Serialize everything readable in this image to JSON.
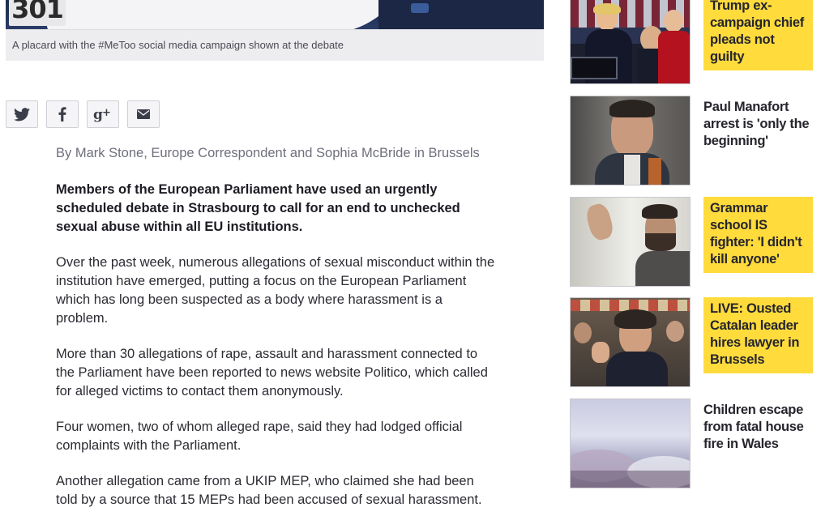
{
  "hero": {
    "plate_text": "301",
    "caption": "A placard with the #MeToo social media campaign shown at the debate"
  },
  "share": {
    "buttons": [
      {
        "name": "twitter",
        "icon": "twitter-icon"
      },
      {
        "name": "facebook",
        "icon": "facebook-icon"
      },
      {
        "name": "google-plus",
        "icon": "google-plus-icon"
      },
      {
        "name": "email",
        "icon": "email-icon"
      }
    ]
  },
  "article": {
    "byline": "By Mark Stone, Europe Correspondent and Sophia McBride in Brussels",
    "paragraphs": [
      "Members of the European Parliament have used an urgently scheduled debate in Strasbourg to call for an end to unchecked sexual abuse within all EU institutions.",
      "Over the past week, numerous allegations of sexual misconduct within the institution have emerged, putting a focus on the European Parliament which has long been suspected as a body where harassment is a problem.",
      "More than 30 allegations of rape, assault and harassment connected to the Parliament have been reported to news website Politico, which called for alleged victims to contact them anonymously.",
      "Four women, two of whom alleged rape, said they had lodged official complaints with the Parliament.",
      "Another allegation came from a UKIP MEP, who claimed she had been told by a source that 15 MEPs had been accused of sexual harassment."
    ]
  },
  "sidebar": {
    "stories": [
      {
        "headline": "Trump ex-campaign chief pleads not guilty",
        "highlighted": true
      },
      {
        "headline": "Paul Manafort arrest is 'only the beginning'",
        "highlighted": false
      },
      {
        "headline": "Grammar school IS fighter: 'I didn't kill anyone'",
        "highlighted": true
      },
      {
        "headline": "LIVE: Ousted Catalan leader hires lawyer in Brussels",
        "highlighted": true
      },
      {
        "headline": "Children escape from fatal house fire in Wales",
        "highlighted": false
      }
    ]
  },
  "colors": {
    "highlight": "#ffdb3c",
    "text": "#25252d",
    "byline": "#6d6f7c",
    "caption_bg": "#ededef"
  }
}
